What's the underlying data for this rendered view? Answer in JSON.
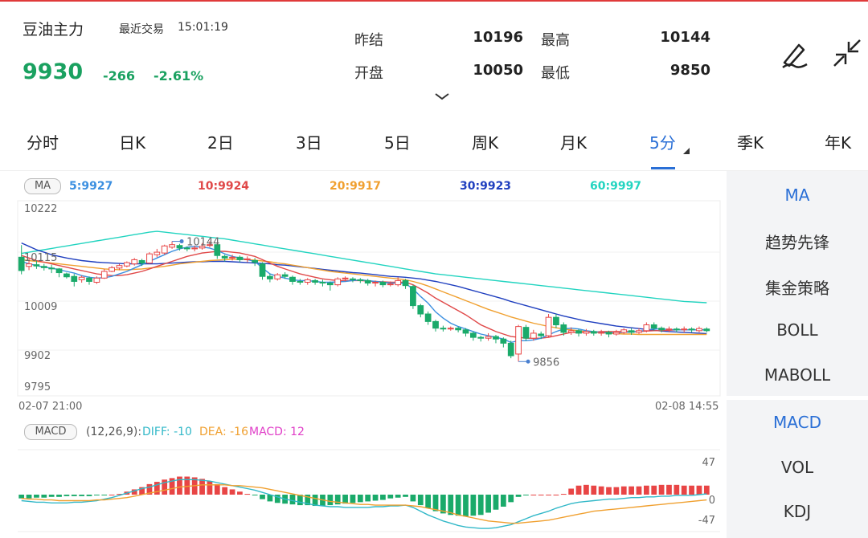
{
  "header": {
    "name": "豆油主力",
    "recent_label": "最近交易",
    "time": "15:01:19",
    "price": "9930",
    "change": "-266",
    "change_pct": "-2.61%",
    "stats": [
      {
        "label": "昨结",
        "value": "10196"
      },
      {
        "label": "最高",
        "value": "10144"
      },
      {
        "label": "开盘",
        "value": "10050"
      },
      {
        "label": "最低",
        "value": "9850"
      }
    ],
    "expand_icon": "chevron-down-icon",
    "draw_icon": "pen-icon",
    "collapse_icon": "shrink-arrows-icon"
  },
  "tabs": [
    "分时",
    "日K",
    "2日",
    "3日",
    "5日",
    "周K",
    "月K",
    "5分",
    "季K",
    "年K"
  ],
  "active_tab": "5分",
  "ma_bar": {
    "badge": "MA",
    "items": [
      {
        "text": "5:9927",
        "color": "#3b8fe0"
      },
      {
        "text": "10:9924",
        "color": "#e04848"
      },
      {
        "text": "20:9917",
        "color": "#f0a030"
      },
      {
        "text": "30:9923",
        "color": "#1f3fbf"
      },
      {
        "text": "60:9997",
        "color": "#22d4c0"
      }
    ]
  },
  "kline": {
    "y_labels": [
      "10222",
      "10115",
      "10009",
      "9902",
      "9795"
    ],
    "x_start": "02-07 21:00",
    "x_end": "02-08 14:55",
    "high_marker": "10144",
    "low_marker": "9856",
    "up_color": "#e84545",
    "down_color": "#1aaa6a"
  },
  "macd_bar": {
    "badge": "MACD",
    "params": "(12,26,9):",
    "diff": "DIFF: -10",
    "dea": "DEA: -16",
    "macd": "MACD: 12",
    "diff_color": "#32b8c8",
    "dea_color": "#f0a030",
    "macd_color": "#e040c8"
  },
  "macd_axis": {
    "top": "47",
    "mid": "0",
    "bottom": "-47"
  },
  "indicators_main": [
    "MA",
    "趋势先锋",
    "集金策略",
    "BOLL",
    "MABOLL"
  ],
  "indicators_sub": [
    "MACD",
    "VOL",
    "KDJ"
  ],
  "active_main": "MA",
  "active_sub": "MACD",
  "chart_data": {
    "type": "candlestick",
    "ylim": [
      9795,
      10222
    ],
    "x_range": [
      "02-07 21:00",
      "02-08 14:55"
    ],
    "candles": [
      [
        10106,
        10074,
        10135,
        10065
      ],
      [
        10084,
        10090,
        10102,
        10075
      ],
      [
        10088,
        10085,
        10098,
        10078
      ],
      [
        10084,
        10081,
        10090,
        10074
      ],
      [
        10080,
        10078,
        10088,
        10068
      ],
      [
        10078,
        10069,
        10080,
        10058
      ],
      [
        10066,
        10059,
        10069,
        10055
      ],
      [
        10060,
        10048,
        10066,
        10036
      ],
      [
        10052,
        10058,
        10062,
        10045
      ],
      [
        10056,
        10048,
        10060,
        10040
      ],
      [
        10046,
        10056,
        10060,
        10042
      ],
      [
        10056,
        10072,
        10078,
        10054
      ],
      [
        10072,
        10081,
        10085,
        10070
      ],
      [
        10080,
        10086,
        10090,
        10075
      ],
      [
        10085,
        10093,
        10096,
        10082
      ],
      [
        10090,
        10100,
        10104,
        10086
      ],
      [
        10098,
        10092,
        10102,
        10085
      ],
      [
        10092,
        10114,
        10118,
        10090
      ],
      [
        10112,
        10118,
        10126,
        10106
      ],
      [
        10116,
        10133,
        10136,
        10112
      ],
      [
        10130,
        10136,
        10144,
        10126
      ],
      [
        10134,
        10128,
        10138,
        10122
      ],
      [
        10128,
        10126,
        10132,
        10120
      ],
      [
        10126,
        10128,
        10134,
        10120
      ],
      [
        10128,
        10132,
        10140,
        10124
      ],
      [
        10134,
        10136,
        10144,
        10130
      ],
      [
        10136,
        10110,
        10140,
        10102
      ],
      [
        10108,
        10104,
        10112,
        10096
      ],
      [
        10104,
        10106,
        10112,
        10098
      ],
      [
        10106,
        10100,
        10110,
        10094
      ],
      [
        10100,
        10102,
        10108,
        10094
      ],
      [
        10098,
        10094,
        10104,
        10085
      ],
      [
        10090,
        10060,
        10094,
        10052
      ],
      [
        10060,
        10054,
        10066,
        10046
      ],
      [
        10054,
        10064,
        10068,
        10050
      ],
      [
        10064,
        10060,
        10070,
        10054
      ],
      [
        10058,
        10048,
        10062,
        10040
      ],
      [
        10048,
        10046,
        10054,
        10040
      ],
      [
        10046,
        10052,
        10056,
        10040
      ],
      [
        10050,
        10046,
        10054,
        10040
      ],
      [
        10046,
        10044,
        10052,
        10036
      ],
      [
        10044,
        10040,
        10048,
        10026
      ],
      [
        10040,
        10054,
        10058,
        10036
      ],
      [
        10054,
        10056,
        10060,
        10048
      ],
      [
        10054,
        10052,
        10058,
        10046
      ],
      [
        10052,
        10050,
        10056,
        10044
      ],
      [
        10050,
        10044,
        10054,
        10038
      ],
      [
        10044,
        10046,
        10050,
        10036
      ],
      [
        10046,
        10040,
        10050,
        10034
      ],
      [
        10040,
        10042,
        10048,
        10036
      ],
      [
        10040,
        10050,
        10058,
        10036
      ],
      [
        10050,
        10038,
        10054,
        10030
      ],
      [
        10036,
        9990,
        10040,
        9982
      ],
      [
        9990,
        9970,
        9994,
        9962
      ],
      [
        9970,
        9952,
        9976,
        9944
      ],
      [
        9952,
        9936,
        9956,
        9928
      ],
      [
        9936,
        9934,
        9942,
        9928
      ],
      [
        9934,
        9936,
        9940,
        9930
      ],
      [
        9936,
        9932,
        9940,
        9926
      ],
      [
        9932,
        9924,
        9936,
        9916
      ],
      [
        9924,
        9914,
        9928,
        9906
      ],
      [
        9914,
        9912,
        9918,
        9904
      ],
      [
        9912,
        9916,
        9924,
        9906
      ],
      [
        9916,
        9910,
        9920,
        9900
      ],
      [
        9910,
        9900,
        9914,
        9890
      ],
      [
        9900,
        9870,
        9906,
        9864
      ],
      [
        9874,
        9940,
        9944,
        9856
      ],
      [
        9938,
        9912,
        9944,
        9906
      ],
      [
        9912,
        9924,
        9932,
        9906
      ],
      [
        9922,
        9918,
        9928,
        9910
      ],
      [
        9918,
        9962,
        9970,
        9914
      ],
      [
        9962,
        9944,
        9970,
        9936
      ],
      [
        9944,
        9926,
        9950,
        9918
      ],
      [
        9926,
        9930,
        9938,
        9920
      ],
      [
        9930,
        9924,
        9934,
        9916
      ],
      [
        9924,
        9928,
        9934,
        9918
      ],
      [
        9928,
        9924,
        9932,
        9918
      ],
      [
        9924,
        9926,
        9932,
        9918
      ],
      [
        9926,
        9922,
        9930,
        9914
      ],
      [
        9922,
        9926,
        9932,
        9918
      ],
      [
        9926,
        9932,
        9936,
        9922
      ],
      [
        9930,
        9926,
        9936,
        9920
      ],
      [
        9926,
        9930,
        9936,
        9922
      ],
      [
        9930,
        9944,
        9950,
        9926
      ],
      [
        9944,
        9936,
        9950,
        9930
      ],
      [
        9936,
        9932,
        9940,
        9926
      ],
      [
        9932,
        9934,
        9940,
        9926
      ],
      [
        9934,
        9932,
        9938,
        9926
      ],
      [
        9932,
        9934,
        9940,
        9926
      ],
      [
        9934,
        9932,
        9938,
        9926
      ],
      [
        9930,
        9935,
        9940,
        9926
      ],
      [
        9934,
        9930,
        9938,
        9926
      ]
    ],
    "ma5": [
      10096,
      10090,
      10086,
      10082,
      10080,
      10076,
      10072,
      10068,
      10062,
      10058,
      10056,
      10057,
      10060,
      10066,
      10072,
      10080,
      10088,
      10096,
      10104,
      10112,
      10120,
      10126,
      10130,
      10132,
      10130,
      10128,
      10122,
      10114,
      10108,
      10104,
      10100,
      10096,
      10080,
      10066,
      10060,
      10056,
      10052,
      10050,
      10050,
      10048,
      10046,
      10046,
      10047,
      10048,
      10050,
      10052,
      10050,
      10048,
      10046,
      10044,
      10044,
      10043,
      10030,
      10012,
      9996,
      9975,
      9960,
      9948,
      9940,
      9934,
      9928,
      9922,
      9918,
      9914,
      9910,
      9902,
      9906,
      9906,
      9908,
      9912,
      9920,
      9928,
      9934,
      9936,
      9934,
      9930,
      9928,
      9926,
      9925,
      9925,
      9926,
      9927,
      9928,
      9932,
      9934,
      9934,
      9933,
      9932,
      9932,
      9932,
      9932,
      9932
    ],
    "ma10": [
      10110,
      10104,
      10098,
      10094,
      10090,
      10086,
      10082,
      10078,
      10074,
      10070,
      10066,
      10064,
      10062,
      10062,
      10064,
      10068,
      10072,
      10078,
      10084,
      10090,
      10096,
      10102,
      10108,
      10112,
      10116,
      10118,
      10120,
      10120,
      10118,
      10116,
      10112,
      10108,
      10100,
      10092,
      10084,
      10078,
      10072,
      10066,
      10062,
      10058,
      10054,
      10052,
      10050,
      10050,
      10050,
      10050,
      10049,
      10048,
      10047,
      10046,
      10046,
      10046,
      10040,
      10030,
      10020,
      10008,
      9998,
      9988,
      9978,
      9968,
      9956,
      9944,
      9936,
      9928,
      9922,
      9916,
      9914,
      9912,
      9912,
      9912,
      9914,
      9918,
      9922,
      9926,
      9926,
      9926,
      9927,
      9928,
      9928,
      9928,
      9928,
      9928,
      9928,
      9929,
      9930,
      9930,
      9931,
      9932,
      9932,
      9932,
      9932,
      9932
    ],
    "ma20": [
      10100,
      10098,
      10096,
      10094,
      10092,
      10090,
      10088,
      10086,
      10084,
      10082,
      10080,
      10078,
      10077,
      10076,
      10076,
      10077,
      10078,
      10080,
      10082,
      10084,
      10087,
      10090,
      10092,
      10094,
      10096,
      10098,
      10099,
      10100,
      10101,
      10101,
      10100,
      10099,
      10097,
      10095,
      10092,
      10090,
      10087,
      10084,
      10081,
      10078,
      10075,
      10072,
      10070,
      10068,
      10066,
      10064,
      10062,
      10060,
      10058,
      10056,
      10054,
      10052,
      10048,
      10043,
      10037,
      10030,
      10023,
      10016,
      10009,
      10002,
      9995,
      9988,
      9981,
      9975,
      9969,
      9963,
      9958,
      9953,
      9948,
      9944,
      9940,
      9937,
      9934,
      9932,
      9930,
      9928,
      9926,
      9925,
      9924,
      9923,
      9922,
      9922,
      9921,
      9921,
      9921,
      9921,
      9921,
      9921,
      9921,
      9921,
      9921,
      9921
    ],
    "ma30": [
      10140,
      10132,
      10124,
      10118,
      10112,
      10108,
      10104,
      10101,
      10098,
      10096,
      10094,
      10093,
      10092,
      10091,
      10090,
      10090,
      10090,
      10090,
      10090,
      10091,
      10092,
      10093,
      10094,
      10095,
      10095,
      10096,
      10096,
      10096,
      10095,
      10094,
      10093,
      10092,
      10091,
      10090,
      10088,
      10087,
      10085,
      10083,
      10081,
      10079,
      10077,
      10075,
      10073,
      10071,
      10069,
      10068,
      10066,
      10064,
      10062,
      10060,
      10059,
      10058,
      10056,
      10054,
      10051,
      10048,
      10044,
      10040,
      10036,
      10031,
      10026,
      10021,
      10016,
      10011,
      10006,
      10000,
      9995,
      9990,
      9985,
      9980,
      9975,
      9970,
      9965,
      9961,
      9957,
      9953,
      9950,
      9947,
      9944,
      9941,
      9939,
      9937,
      9935,
      9933,
      9931,
      9929,
      9928,
      9927,
      9926,
      9925,
      9924,
      9923
    ],
    "ma60": [
      10115,
      10118,
      10121,
      10124,
      10127,
      10130,
      10133,
      10136,
      10139,
      10142,
      10145,
      10148,
      10151,
      10154,
      10157,
      10160,
      10163,
      10166,
      10168,
      10166,
      10164,
      10162,
      10160,
      10158,
      10156,
      10154,
      10152,
      10150,
      10147,
      10144,
      10141,
      10138,
      10135,
      10132,
      10129,
      10126,
      10123,
      10120,
      10117,
      10114,
      10111,
      10108,
      10105,
      10102,
      10099,
      10096,
      10093,
      10090,
      10087,
      10084,
      10081,
      10078,
      10075,
      10072,
      10069,
      10066,
      10064,
      10062,
      10060,
      10058,
      10056,
      10054,
      10052,
      10050,
      10048,
      10046,
      10044,
      10042,
      10040,
      10038,
      10036,
      10034,
      10032,
      10030,
      10028,
      10026,
      10024,
      10022,
      10020,
      10018,
      10016,
      10014,
      10012,
      10010,
      10008,
      10006,
      10004,
      10002,
      10000,
      9999,
      9998,
      9997
    ],
    "macd_hist": [
      -5,
      -5,
      -4,
      -4,
      -3,
      -3,
      -2,
      -2,
      -2,
      -2,
      -1,
      -1,
      0,
      1,
      4,
      7,
      10,
      14,
      17,
      20,
      22,
      24,
      24,
      23,
      21,
      18,
      14,
      10,
      7,
      4,
      1,
      -1,
      -6,
      -9,
      -11,
      -12,
      -13,
      -14,
      -14,
      -15,
      -15,
      -14,
      -13,
      -12,
      -11,
      -10,
      -9,
      -8,
      -7,
      -5,
      -4,
      -3,
      -9,
      -14,
      -18,
      -22,
      -25,
      -27,
      -28,
      -29,
      -28,
      -27,
      -24,
      -20,
      -16,
      -10,
      -3,
      -1,
      0,
      0,
      0,
      0,
      1,
      8,
      12,
      13,
      12,
      11,
      10,
      10,
      11,
      11,
      11,
      12,
      12,
      13,
      13,
      13,
      12,
      12,
      12,
      12
    ],
    "macd_diff": [
      -8,
      -9,
      -10,
      -10,
      -11,
      -11,
      -11,
      -10,
      -10,
      -9,
      -8,
      -6,
      -4,
      -1,
      2,
      5,
      8,
      10,
      13,
      16,
      18,
      20,
      20,
      20,
      19,
      18,
      16,
      14,
      12,
      10,
      8,
      6,
      3,
      0,
      -3,
      -6,
      -8,
      -10,
      -12,
      -14,
      -15,
      -16,
      -16,
      -17,
      -17,
      -17,
      -17,
      -16,
      -16,
      -15,
      -15,
      -14,
      -17,
      -22,
      -27,
      -31,
      -35,
      -38,
      -41,
      -43,
      -44,
      -45,
      -45,
      -44,
      -42,
      -40,
      -36,
      -32,
      -28,
      -25,
      -22,
      -18,
      -15,
      -12,
      -10,
      -9,
      -8,
      -7,
      -6,
      -6,
      -5,
      -4,
      -4,
      -3,
      -3,
      -2,
      -2,
      -1,
      -1,
      -1,
      0,
      1
    ],
    "macd_dea": [
      -5,
      -6,
      -6,
      -7,
      -7,
      -8,
      -8,
      -8,
      -8,
      -8,
      -7,
      -7,
      -6,
      -5,
      -4,
      -2,
      0,
      2,
      4,
      6,
      8,
      10,
      11,
      12,
      13,
      13,
      13,
      13,
      12,
      12,
      11,
      10,
      9,
      7,
      5,
      3,
      1,
      -1,
      -3,
      -5,
      -7,
      -9,
      -10,
      -11,
      -12,
      -13,
      -13,
      -14,
      -14,
      -14,
      -14,
      -14,
      -15,
      -16,
      -18,
      -20,
      -22,
      -24,
      -27,
      -29,
      -31,
      -33,
      -35,
      -36,
      -37,
      -38,
      -38,
      -37,
      -36,
      -35,
      -34,
      -32,
      -30,
      -28,
      -26,
      -24,
      -22,
      -21,
      -20,
      -19,
      -18,
      -17,
      -16,
      -15,
      -14,
      -13,
      -12,
      -11,
      -10,
      -9,
      -8,
      -7
    ]
  }
}
